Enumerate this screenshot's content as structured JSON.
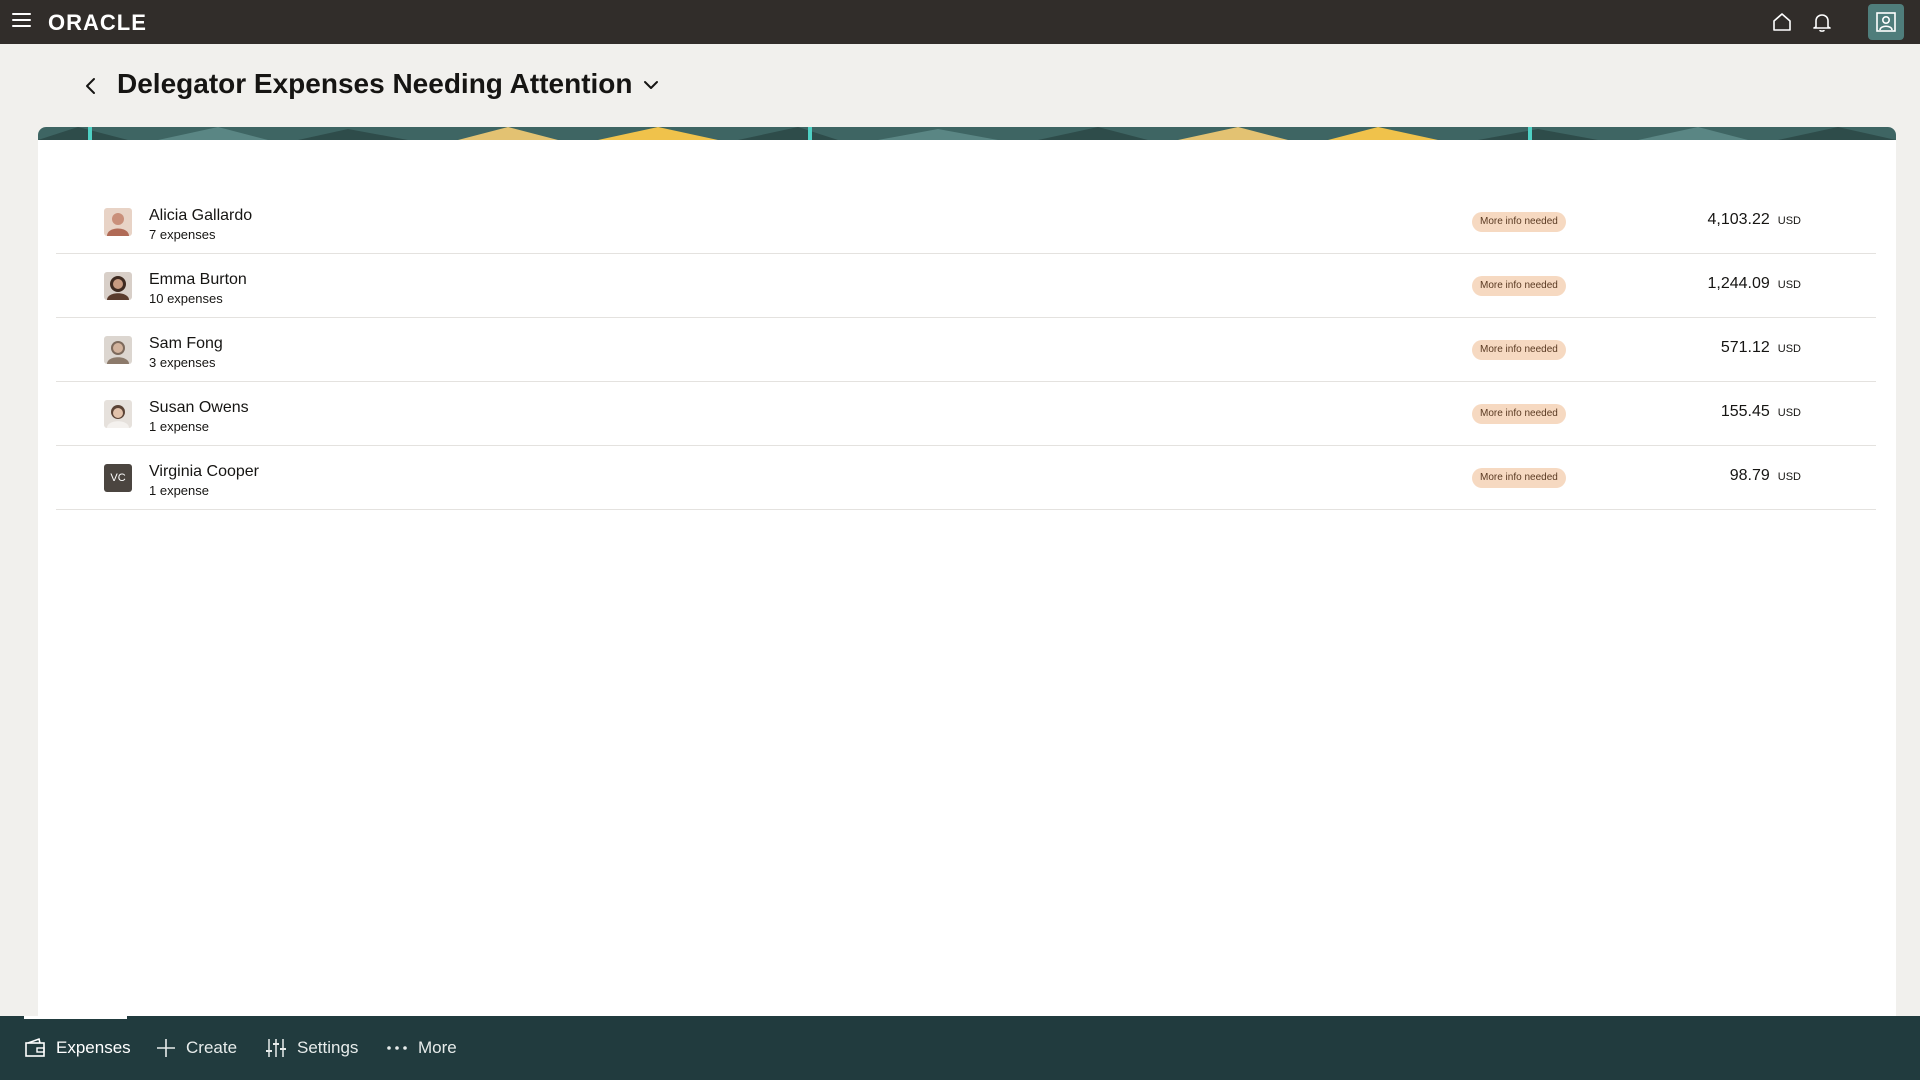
{
  "app": {
    "brand": "ORACLE"
  },
  "header": {
    "title": "Delegator Expenses Needing Attention"
  },
  "rows": [
    {
      "name": "Alicia Gallardo",
      "count": "7 expenses",
      "status": "More info needed",
      "amount": "4,103.22",
      "currency": "USD",
      "avatar_type": "photo",
      "avatar_color": "#c98f7a"
    },
    {
      "name": "Emma Burton",
      "count": "10 expenses",
      "status": "More info needed",
      "amount": "1,244.09",
      "currency": "USD",
      "avatar_type": "photo",
      "avatar_color": "#5a3b2c"
    },
    {
      "name": "Sam Fong",
      "count": "3 expenses",
      "status": "More info needed",
      "amount": "571.12",
      "currency": "USD",
      "avatar_type": "photo",
      "avatar_color": "#8c7a6b"
    },
    {
      "name": "Susan Owens",
      "count": "1 expense",
      "status": "More info needed",
      "amount": "155.45",
      "currency": "USD",
      "avatar_type": "photo",
      "avatar_color": "#a88b74"
    },
    {
      "name": "Virginia Cooper",
      "count": "1 expense",
      "status": "More info needed",
      "amount": "98.79",
      "currency": "USD",
      "avatar_type": "initials",
      "initials": "VC"
    }
  ],
  "bottom_nav": {
    "items": [
      {
        "label": "Expenses",
        "icon": "wallet-icon",
        "active": true
      },
      {
        "label": "Create",
        "icon": "plus-icon",
        "active": false
      },
      {
        "label": "Settings",
        "icon": "sliders-icon",
        "active": false
      },
      {
        "label": "More",
        "icon": "ellipsis-icon",
        "active": false
      }
    ]
  },
  "colors": {
    "topbar": "#312d2a",
    "bottombar": "#213b3e",
    "badge_bg": "#f6d9c1",
    "avatar_btn": "#4f7d7b"
  }
}
